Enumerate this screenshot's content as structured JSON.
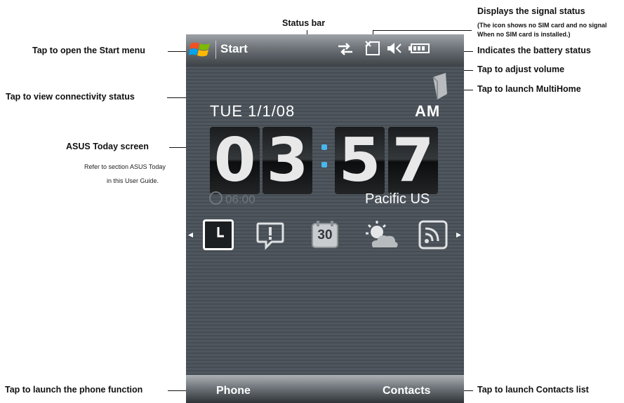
{
  "callouts": {
    "status_bar": "Status bar",
    "signal_title": "Displays the signal status",
    "signal_note_1": "(The icon shows no SIM card and no signal",
    "signal_note_2": "When no SIM card is installed.)",
    "start_menu": "Tap to open the Start menu",
    "battery": "Indicates the battery status",
    "volume": "Tap to adjust volume",
    "connectivity": "Tap to view connectivity status",
    "multihome": "Tap to launch MultiHome",
    "today_title": "ASUS Today screen",
    "today_note_1": "Refer to section ASUS Today",
    "today_note_2": "in this User Guide.",
    "phone": "Tap to launch the phone function",
    "contacts": "Tap to launch Contacts list"
  },
  "device": {
    "start_label": "Start",
    "date": "TUE 1/1/08",
    "ampm": "AM",
    "time_digits": [
      "0",
      "3",
      "5",
      "7"
    ],
    "alarm_time": "06:00",
    "time_zone": "Pacific US",
    "calendar_day": "30",
    "soft_left": "Phone",
    "soft_right": "Contacts",
    "colors": {
      "colon": "#47b7ee",
      "status_bar": "#6b7176",
      "background": "#4d545b"
    },
    "icons": [
      "windows-logo-icon",
      "connectivity-icon",
      "no-sim-signal-icon",
      "volume-icon",
      "battery-icon",
      "multihome-icon",
      "clock-app-icon",
      "alert-app-icon",
      "calendar-app-icon",
      "weather-app-icon",
      "rss-app-icon"
    ]
  }
}
